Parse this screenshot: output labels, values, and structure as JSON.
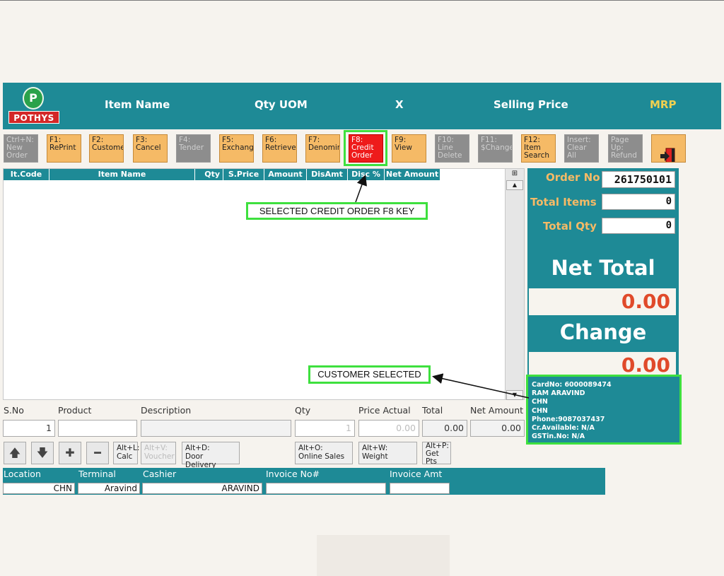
{
  "logo": {
    "badge": "P",
    "text": "POTHYS"
  },
  "header": {
    "item_name": "Item Name",
    "qty_uom": "Qty UOM",
    "x": "X",
    "selling_price": "Selling Price",
    "mrp": "MRP"
  },
  "fkeys": [
    {
      "label": "Ctrl+N:\nNew\nOrder",
      "state": "off"
    },
    {
      "label": "F1:\nRePrint",
      "state": "on"
    },
    {
      "label": "F2:\nCustome",
      "state": "on"
    },
    {
      "label": "F3:\nCancel",
      "state": "on"
    },
    {
      "label": "F4:\nTender",
      "state": "off"
    },
    {
      "label": "F5:\nExchang",
      "state": "on"
    },
    {
      "label": "F6:\nRetrieve",
      "state": "on"
    },
    {
      "label": "F7:\nDenomin",
      "state": "on"
    },
    {
      "label": "F8:\nCredit\nOrder",
      "state": "red"
    },
    {
      "label": "F9:\nView",
      "state": "on"
    },
    {
      "label": "F10:\nLine\nDelete",
      "state": "off"
    },
    {
      "label": "F11:\n$Change",
      "state": "off"
    },
    {
      "label": "F12:\nItem\nSearch",
      "state": "on"
    },
    {
      "label": "Insert:\nClear All",
      "state": "off"
    },
    {
      "label": "Page\nUp:\nRefund",
      "state": "off"
    }
  ],
  "grid": {
    "columns": [
      "It.Code",
      "Item Name",
      "Qty",
      "S.Price",
      "Amount",
      "DisAmt",
      "Disc %",
      "Net Amount"
    ]
  },
  "order": {
    "order_no_label": "Order No",
    "order_no": "261750101",
    "total_items_label": "Total Items",
    "total_items": "0",
    "total_qty_label": "Total Qty",
    "total_qty": "0",
    "net_total_label": "Net Total",
    "net_total": "0.00",
    "change_label": "Change",
    "change": "0.00"
  },
  "customer": {
    "card": "CardNo: 6000089474",
    "name": "RAM ARAVIND",
    "line1": "CHN",
    "line2": "CHN",
    "phone": "Phone:9087037437",
    "credit": "Cr.Available: N/A",
    "gstin": "GSTin.No: N/A"
  },
  "annotations": {
    "credit_order": "SELECTED CREDIT ORDER F8 KEY",
    "customer": "CUSTOMER SELECTED"
  },
  "entry": {
    "sno_label": "S.No",
    "product_label": "Product",
    "description_label": "Description",
    "qty_label": "Qty",
    "price_actual_label": "Price Actual",
    "total_label": "Total",
    "net_amount_label": "Net Amount",
    "sno": "1",
    "product": "",
    "description": "",
    "qty": "1",
    "price_actual": "0.00",
    "total": "0.00",
    "net_amount": "0.00"
  },
  "shortcuts": {
    "calc": "Alt+L:\nCalc",
    "voucher": "Alt+V:\nVoucher",
    "door_delivery": "Alt+D:\nDoor Delivery",
    "online_sales": "Alt+O:\nOnline Sales",
    "weight": "Alt+W:\nWeight",
    "get_pts": "Alt+P:\nGet\nPts"
  },
  "footer": {
    "location_label": "Location",
    "terminal_label": "Terminal",
    "cashier_label": "Cashier",
    "invoice_no_label": "Invoice No#",
    "invoice_amt_label": "Invoice Amt",
    "location": "CHN",
    "terminal": "Aravind",
    "cashier": "ARAVIND",
    "invoice_no": "",
    "invoice_amt": ""
  },
  "colors": {
    "teal": "#1e8a96",
    "orange": "#f5ba66",
    "red": "#ee1b1b",
    "value_red": "#e04a2a",
    "highlight_green": "#3ee03e",
    "mrp_yellow": "#f0d050"
  }
}
